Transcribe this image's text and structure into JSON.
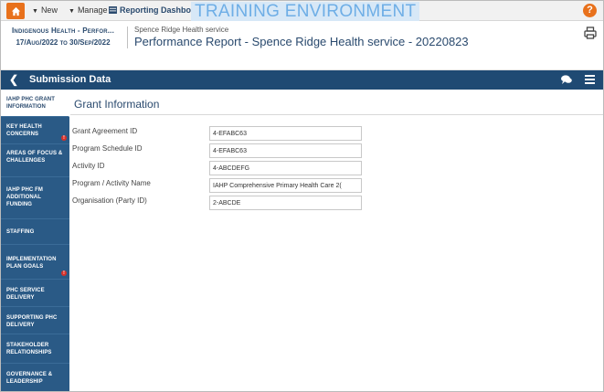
{
  "topbar": {
    "new_label": "New",
    "manage_label": "Manage",
    "dashboard_label": "Reporting Dashboard",
    "environment_banner": "TRAINING ENVIRONMENT",
    "help_label": "?"
  },
  "header": {
    "report_type": "Indigenous Health - Perfor...",
    "period": "17/Aug/2022 to 30/Sep/2022",
    "service_name": "Spence Ridge Health service",
    "report_title": "Performance Report - Spence Ridge Health service - 20220823"
  },
  "submission_bar": {
    "title": "Submission Data"
  },
  "sidebar": {
    "items": [
      {
        "label": "IAHP PHC Grant Information",
        "active": true,
        "warning": false
      },
      {
        "label": "Key Health Concerns",
        "active": false,
        "warning": true
      },
      {
        "label": "Areas of Focus & Challenges",
        "active": false,
        "warning": false
      },
      {
        "label": "IAHP PHC FM Additional Funding",
        "active": false,
        "warning": false
      },
      {
        "label": "Staffing",
        "active": false,
        "warning": false
      },
      {
        "label": "Implementation Plan Goals",
        "active": false,
        "warning": true
      },
      {
        "label": "PHC Service Delivery",
        "active": false,
        "warning": false
      },
      {
        "label": "Supporting PHC Delivery",
        "active": false,
        "warning": false
      },
      {
        "label": "Stakeholder Relationships",
        "active": false,
        "warning": false
      },
      {
        "label": "Governance & Leadership",
        "active": false,
        "warning": false
      }
    ]
  },
  "grant_info": {
    "section_title": "Grant Information",
    "fields": [
      {
        "label": "Grant Agreement ID",
        "value": "4-EFABC63"
      },
      {
        "label": "Program Schedule ID",
        "value": "4-EFABC63"
      },
      {
        "label": "Activity ID",
        "value": "4-ABCDEFG"
      },
      {
        "label": "Program / Activity Name",
        "value": "IAHP Comprehensive Primary Health Care 2("
      },
      {
        "label": "Organisation (Party ID)",
        "value": "2-ABCDE"
      }
    ]
  },
  "colors": {
    "accent_orange": "#e8711c",
    "nav_blue": "#2a5a86",
    "bar_blue": "#1f4a73",
    "warning_red": "#d7312a"
  }
}
